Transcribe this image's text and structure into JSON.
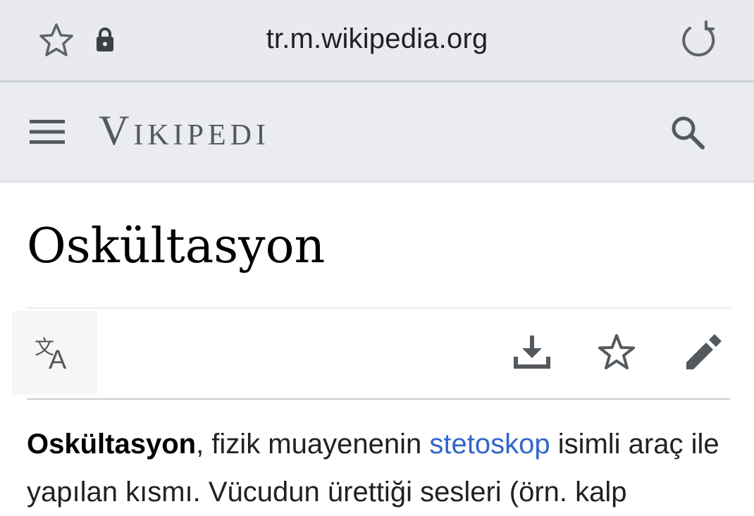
{
  "browser": {
    "url": "tr.m.wikipedia.org",
    "icons": {
      "bookmark": "star-outline-icon",
      "security": "lock-icon",
      "reload": "reload-icon"
    }
  },
  "header": {
    "logo_text": "Vikipedi",
    "icons": {
      "menu": "hamburger-menu-icon",
      "search": "search-icon"
    }
  },
  "page": {
    "title": "Oskültasyon",
    "actions": {
      "language": "language-icon",
      "download": "download-icon",
      "watch": "star-icon",
      "edit": "pencil-icon"
    },
    "intro": {
      "bold_term": "Oskültasyon",
      "text_1": ", fizik muayenenin ",
      "link": "stetoskop",
      "text_2": " isimli araç ile yapılan kısmı. Vücudun ürettiği sesleri (örn. kalp"
    }
  },
  "colors": {
    "link": "#3366cc",
    "header_bg": "#eaecf0",
    "urlbar_bg": "#e8eaed"
  }
}
